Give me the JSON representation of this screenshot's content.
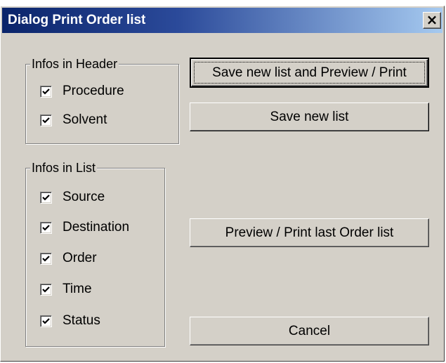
{
  "window": {
    "title": "Dialog Print Order list",
    "close_glyph": "×"
  },
  "header_group": {
    "legend": "Infos in Header",
    "items": [
      {
        "label": "Procedure",
        "checked": true
      },
      {
        "label": "Solvent",
        "checked": true
      }
    ]
  },
  "list_group": {
    "legend": "Infos in List",
    "items": [
      {
        "label": "Source",
        "checked": true
      },
      {
        "label": "Destination",
        "checked": true
      },
      {
        "label": "Order",
        "checked": true
      },
      {
        "label": "Time",
        "checked": true
      },
      {
        "label": "Status",
        "checked": true
      }
    ]
  },
  "buttons": {
    "save_preview_print": "Save new list and Preview / Print",
    "save_new_list": "Save new list",
    "preview_print_last": "Preview / Print last Order list",
    "cancel": "Cancel"
  },
  "icons": {
    "checkmark": "checkmark-icon",
    "close": "close-icon"
  }
}
